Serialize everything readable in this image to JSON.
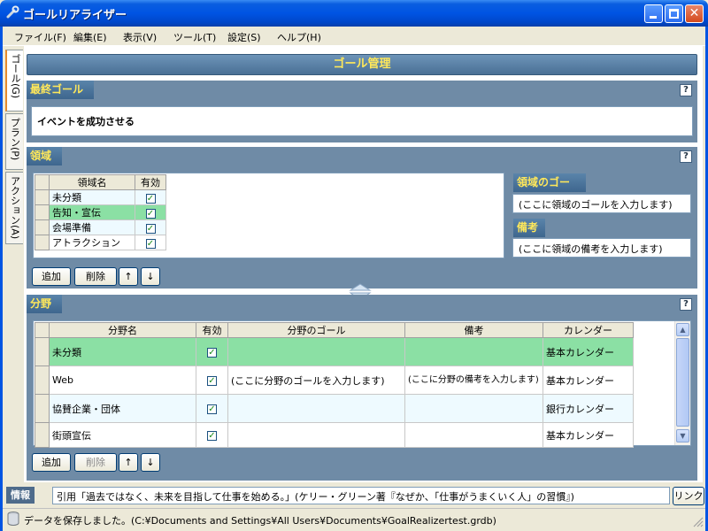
{
  "window": {
    "title": "ゴールリアライザー"
  },
  "menu": [
    {
      "label": "ファイル(F)"
    },
    {
      "label": "編集(E)"
    },
    {
      "label": "表示(V)"
    },
    {
      "label": "ツール(T)"
    },
    {
      "label": "設定(S)"
    },
    {
      "label": "ヘルプ(H)"
    }
  ],
  "vtabs": [
    {
      "label": "ゴール(G)",
      "active": true
    },
    {
      "label": "プラン(P)",
      "active": false
    },
    {
      "label": "アクション(A)",
      "active": false
    }
  ],
  "header": {
    "title": "ゴール管理"
  },
  "final_goal": {
    "label": "最終ゴール",
    "value": "イベントを成功させる",
    "help": "?"
  },
  "domain": {
    "label": "領域",
    "help": "?",
    "columns": [
      "領域名",
      "有効"
    ],
    "rows": [
      {
        "name": "未分類",
        "enabled": true
      },
      {
        "name": "告知・宣伝",
        "enabled": true
      },
      {
        "name": "会場準備",
        "enabled": true
      },
      {
        "name": "アトラクション",
        "enabled": true
      }
    ],
    "goal_label": "領域のゴール",
    "goal_placeholder": "(ここに領域のゴールを入力します)",
    "memo_label": "備考",
    "memo_placeholder": "(ここに領域の備考を入力します)",
    "buttons": {
      "add": "追加",
      "delete": "削除",
      "up": "↑",
      "down": "↓"
    }
  },
  "field": {
    "label": "分野",
    "help": "?",
    "columns": [
      "分野名",
      "有効",
      "分野のゴール",
      "備考",
      "カレンダー"
    ],
    "rows": [
      {
        "name": "未分類",
        "enabled": true,
        "goal": "",
        "memo": "",
        "calendar": "基本カレンダー"
      },
      {
        "name": "Web",
        "enabled": true,
        "goal": "(ここに分野のゴールを入力します)",
        "memo": "(ここに分野の備考を入力します)",
        "calendar": "基本カレンダー"
      },
      {
        "name": "協賛企業・団体",
        "enabled": true,
        "goal": "",
        "memo": "",
        "calendar": "銀行カレンダー"
      },
      {
        "name": "街頭宣伝",
        "enabled": true,
        "goal": "",
        "memo": "",
        "calendar": "基本カレンダー"
      }
    ],
    "buttons": {
      "add": "追加",
      "delete": "削除",
      "up": "↑",
      "down": "↓"
    }
  },
  "info": {
    "label": "情報",
    "text": "引用「過去ではなく、未来を目指して仕事を始める。」(ケリー・グリーン著『なぜか、「仕事がうまくいく人」の習慣』)",
    "link": "リンク"
  },
  "status": {
    "text": "データを保存しました。(C:¥Documents and Settings¥All Users¥Documents¥GoalRealizertest.grdb)"
  },
  "colors": {
    "section_bg": "#6f8ba6",
    "label_text": "#ffe85a",
    "selected_row": "#8be0a4",
    "alt_row": "#eefaff"
  }
}
